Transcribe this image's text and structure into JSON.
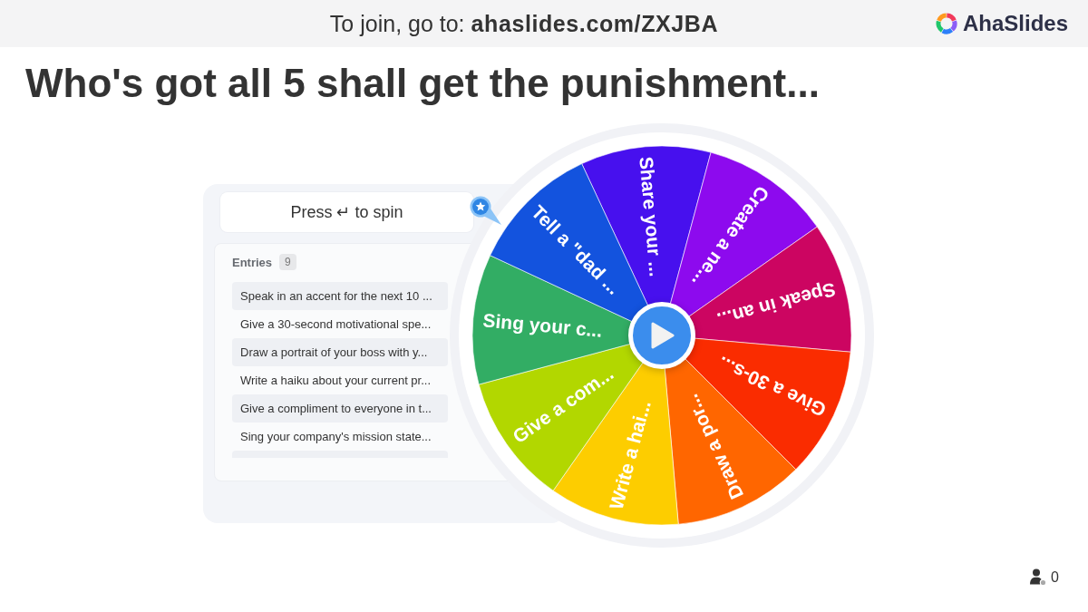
{
  "header": {
    "join_text": "To join, go to: **ahaslides.com/ZXJBA**",
    "brand": "AhaSlides"
  },
  "title": "Who's got all 5 shall get the punishment...",
  "spin_prompt": "Press ↵ to spin",
  "entries": {
    "label": "Entries",
    "count": "9",
    "items": [
      "Speak in an accent for the next 10 ...",
      "Give a 30-second motivational spe...",
      "Draw a portrait of your boss with y...",
      "Write a haiku about your current pr...",
      "Give a compliment to everyone in t...",
      "Sing your company's mission state..."
    ]
  },
  "wheel": {
    "segments": [
      {
        "label": "Share your ...",
        "color": "#4710ee"
      },
      {
        "label": "Create a ne...",
        "color": "#8d0aee"
      },
      {
        "label": "Speak in an...",
        "color": "#cc0561"
      },
      {
        "label": "Give a 30-s...",
        "color": "#fa2c00"
      },
      {
        "label": "Draw a por...",
        "color": "#ff6600"
      },
      {
        "label": "Write a hai...",
        "color": "#fdcd00"
      },
      {
        "label": "Give a com...",
        "color": "#b2d700"
      },
      {
        "label": "Sing your c...",
        "color": "#32ad64"
      },
      {
        "label": "Tell a \"dad ...",
        "color": "#1353de"
      }
    ]
  },
  "participants": {
    "count": "0"
  }
}
